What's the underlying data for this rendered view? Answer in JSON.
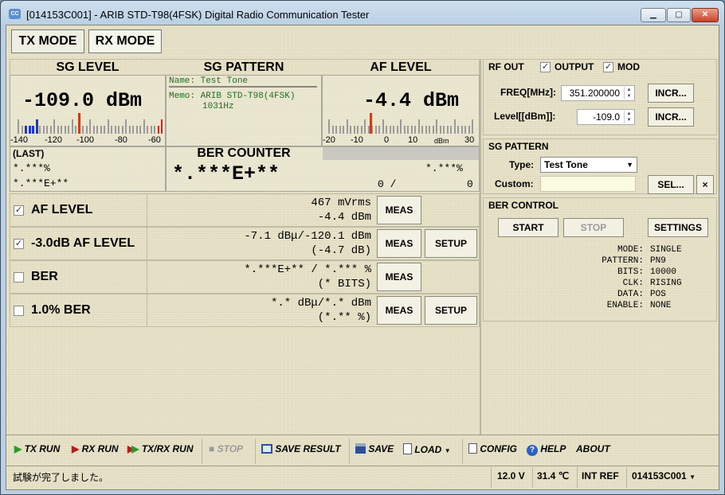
{
  "window": {
    "title": "[014153C001] - ARIB STD-T98(4FSK) Digital Radio Communication Tester",
    "icon": "app-icon"
  },
  "mode_tabs": {
    "tx": "TX MODE",
    "rx": "RX MODE"
  },
  "sg_level": {
    "title": "SG LEVEL",
    "value": "-109.0 dBm",
    "scale": [
      "-140",
      "-120",
      "-100",
      "-80",
      "-60"
    ],
    "last_label": "(LAST)",
    "last_1": "*.***%",
    "last_2": "*.***E+**"
  },
  "sg_pattern": {
    "title": "SG PATTERN",
    "name": "Name: Test Tone",
    "memo": "Memo: ARIB STD-T98(4FSK)",
    "memo_2": "1031Hz"
  },
  "af_level": {
    "title": "AF LEVEL",
    "value": "-4.4 dBm",
    "scale": [
      "-20",
      "-10",
      "0",
      "10",
      "dBm",
      "30"
    ]
  },
  "ber_counter": {
    "title": "BER COUNTER",
    "value": "*.***E+**",
    "pct": "*.***%",
    "count": "0 /",
    "total": "0"
  },
  "measurements": [
    {
      "label": "AF LEVEL",
      "checked": "✓",
      "line1": "467 mVrms",
      "line2": "-4.4 dBm",
      "meas": "MEAS",
      "setup": ""
    },
    {
      "label": "-3.0dB AF LEVEL",
      "checked": "✓",
      "line1": "-7.1 dBμ/-120.1 dBm",
      "line2": "(-4.7 dB)",
      "meas": "MEAS",
      "setup": "SETUP"
    },
    {
      "label": "BER",
      "checked": "",
      "line1": "*.***E+** / *.*** %",
      "line2": "(* BITS)",
      "meas": "MEAS",
      "setup": ""
    },
    {
      "label": "1.0% BER",
      "checked": "",
      "line1": "*.* dBμ/*.* dBm",
      "line2": "(*.** %)",
      "meas": "MEAS",
      "setup": "SETUP"
    }
  ],
  "rf_out": {
    "title": "RF OUT",
    "output_label": "OUTPUT",
    "mod_label": "MOD",
    "check": "✓",
    "freq_label": "FREQ[MHz]:",
    "freq_value": "351.200000",
    "incr": "INCR...",
    "level_label": "Level[[dBm]]:",
    "level_value": "-109.0"
  },
  "sg_pattern_ctrl": {
    "title": "SG PATTERN",
    "type_label": "Type:",
    "type_value": "Test Tone",
    "custom_label": "Custom:",
    "select": "SEL...",
    "clear": "×"
  },
  "ber_control": {
    "title": "BER CONTROL",
    "start": "START",
    "stop": "STOP",
    "settings": "SETTINGS",
    "params": [
      {
        "k": "MODE:",
        "v": "SINGLE"
      },
      {
        "k": "PATTERN:",
        "v": "PN9"
      },
      {
        "k": "BITS:",
        "v": "10000"
      },
      {
        "k": "CLK:",
        "v": "RISING"
      },
      {
        "k": "DATA:",
        "v": "POS"
      },
      {
        "k": "ENABLE:",
        "v": "NONE"
      }
    ]
  },
  "toolbar": {
    "tx_run": "TX RUN",
    "rx_run": "RX RUN",
    "txrx_run": "TX/RX RUN",
    "stop": "STOP",
    "save_result": "SAVE RESULT",
    "save": "SAVE",
    "load": "LOAD",
    "config": "CONFIG",
    "help": "HELP",
    "about": "ABOUT"
  },
  "status": {
    "message": "試験が完了しました。",
    "voltage": "12.0 V",
    "temperature": "31.4 ℃",
    "ref": "INT REF",
    "device": "014153C001"
  },
  "colors": {
    "accent_green": "#1e6e1e",
    "needle": "#c04020",
    "bar_blue": "#1a35d8",
    "bar_red": "#e02020"
  }
}
